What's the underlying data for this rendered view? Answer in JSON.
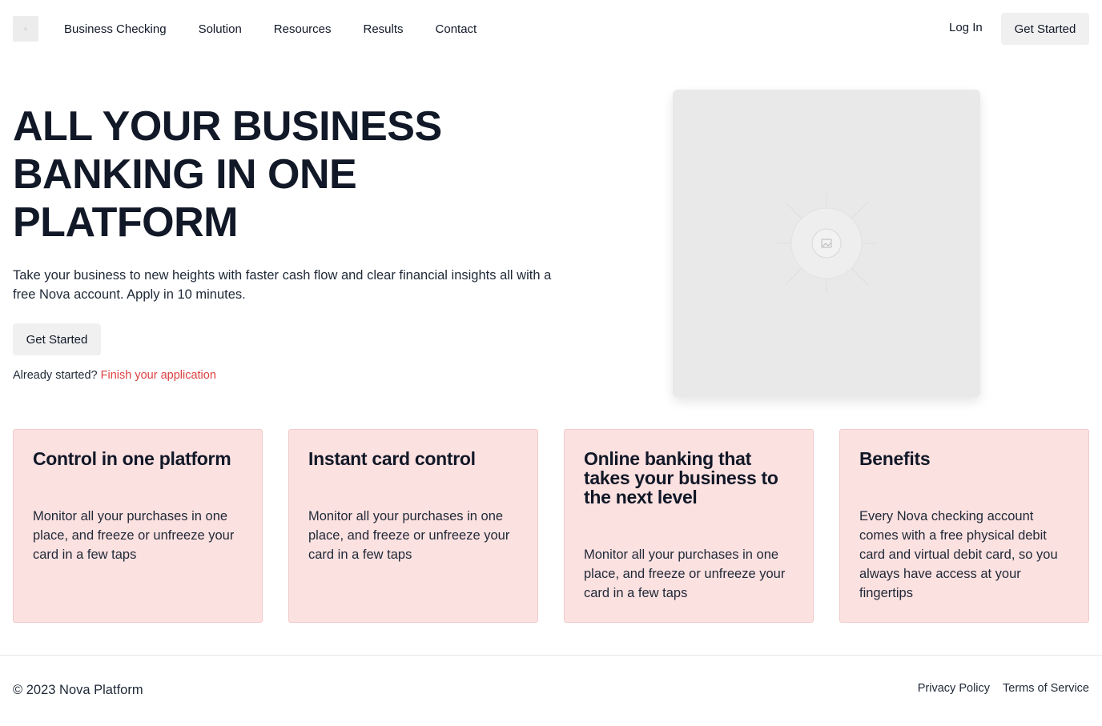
{
  "header": {
    "nav": [
      "Business Checking",
      "Solution",
      "Resources",
      "Results",
      "Contact"
    ],
    "login_label": "Log In",
    "cta_label": "Get Started"
  },
  "hero": {
    "title": "ALL YOUR BUSINESS BANKING IN ONE PLATFORM",
    "description": "Take your business to new heights with faster cash flow and clear financial insights all with a free Nova account. Apply in 10 minutes.",
    "cta_label": "Get Started",
    "already_text": "Already started?",
    "finish_link": "Finish your application",
    "image_icon": "image-placeholder-icon"
  },
  "cards": [
    {
      "title": "Control in one platform",
      "body": "Monitor all your purchases in one place, and freeze or unfreeze your card in a few taps"
    },
    {
      "title": "Instant card control",
      "body": "Monitor all your purchases in one place, and freeze or unfreeze your card in a few taps"
    },
    {
      "title": "Online banking that takes your business to the next level",
      "body": "Monitor all your purchases in one place, and freeze or unfreeze your card in a few taps"
    },
    {
      "title": "Benefits",
      "body": "Every Nova checking account comes with a free physical debit card and virtual debit card, so you always have access at your fingertips"
    }
  ],
  "footer": {
    "copyright": "© 2023 Nova Platform",
    "links": [
      "Privacy Policy",
      "Terms of Service"
    ]
  },
  "colors": {
    "accent_link": "#dc3e3e",
    "card_bg": "#fce1e1",
    "button_bg": "#f0f0f0",
    "text_dark": "#111827"
  }
}
